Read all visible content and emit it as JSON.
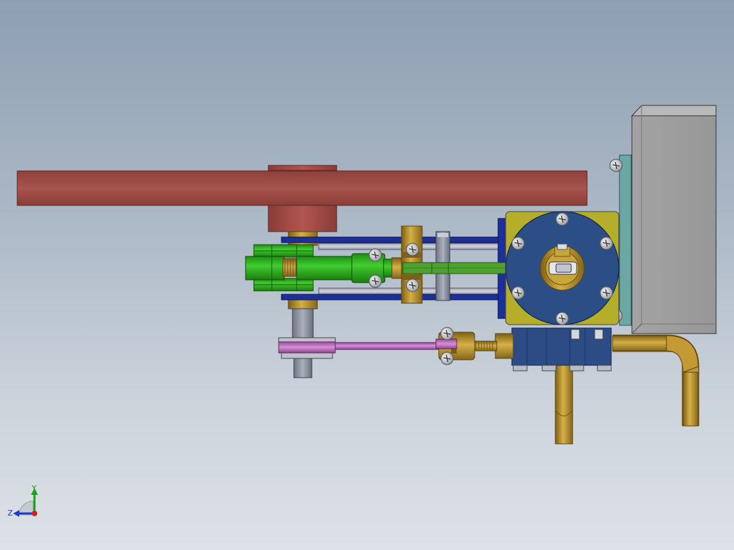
{
  "view": {
    "background_top": "#8e9fb2",
    "background_bottom": "#dde2e7"
  },
  "triad": {
    "x_label": "",
    "y_label": "Y",
    "z_label": "Z"
  },
  "colors": {
    "flywheel": "#9a4a45",
    "hub": "#a04b45",
    "crosshead_green": "#2aa21a",
    "connecting_rod": "#4fa030",
    "frame_blue": "#1c2f9a",
    "cylinder_face": "#2c4e86",
    "cylinder_plate": "#b5ae2a",
    "steam_chest": "#2d4c85",
    "valve_rod": "#c070c0",
    "brass": "#b38a2a",
    "shaft_grey": "#8d93a3",
    "box_grey": "#9d9d9d",
    "mount_teal": "#6aa7a5"
  },
  "icons": [
    "axis-triad-icon",
    "screw-head-icon"
  ]
}
